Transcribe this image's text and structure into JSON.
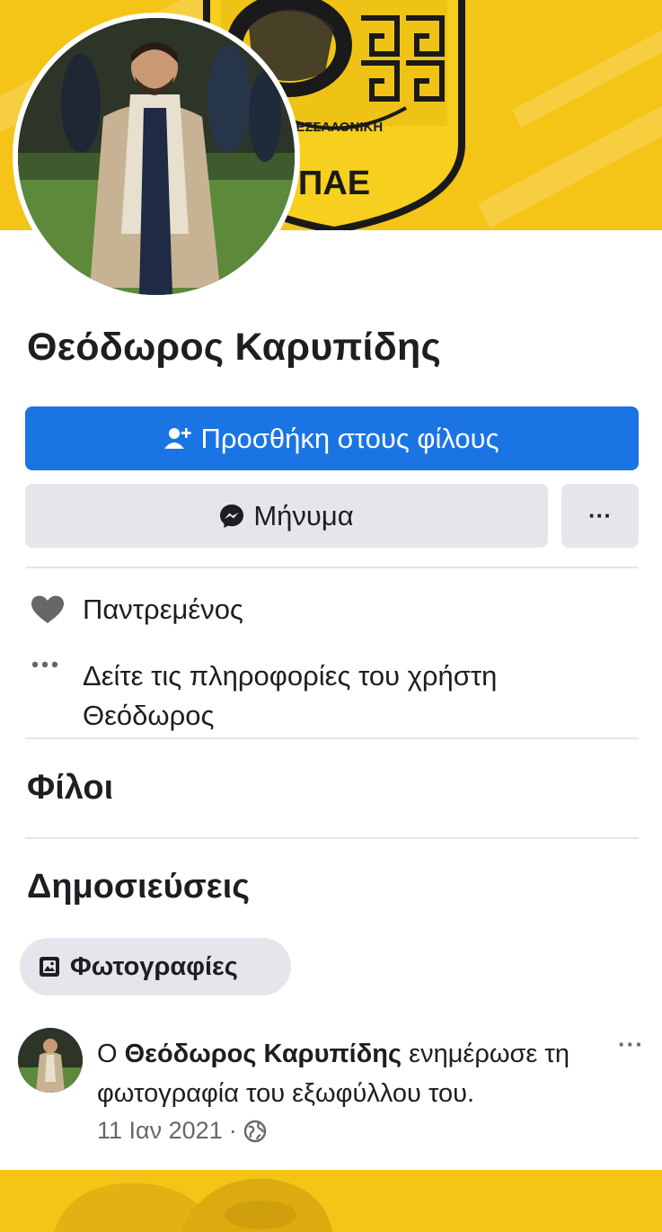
{
  "profile": {
    "name": "Θεόδωρος Καρυπίδης",
    "cover_text": "ΠΑΕ",
    "cover_arc_text": "ΘΕΣΣΑΛΟΝΙΚΗ"
  },
  "actions": {
    "add_friend_label": "Προσθήκη στους φίλους",
    "message_label": "Μήνυμα",
    "more_label": "···"
  },
  "info": {
    "relationship": "Παντρεμένος",
    "see_info": "Δείτε τις πληροφορίες του χρήστη Θεόδωρος"
  },
  "sections": {
    "friends_title": "Φίλοι",
    "posts_title": "Δημοσιεύσεις",
    "photos_chip": "Φωτογραφίες"
  },
  "post": {
    "prefix": "Ο ",
    "author": "Θεόδωρος Καρυπίδης",
    "action": " ενημέρωσε τη φωτογραφία του εξωφύλλου του.",
    "date": "11 Ιαν 2021",
    "separator": "·",
    "more_label": "···"
  },
  "colors": {
    "accent": "#1b74e4",
    "cover_yellow": "#f4c417",
    "button_gray": "#e4e6eb",
    "meta_gray": "#65676b"
  },
  "icons": {
    "add_friend": "person-add-icon",
    "message": "messenger-icon",
    "relationship": "heart-icon",
    "info": "ellipsis-icon",
    "photos": "photo-album-icon",
    "privacy": "globe-icon"
  }
}
